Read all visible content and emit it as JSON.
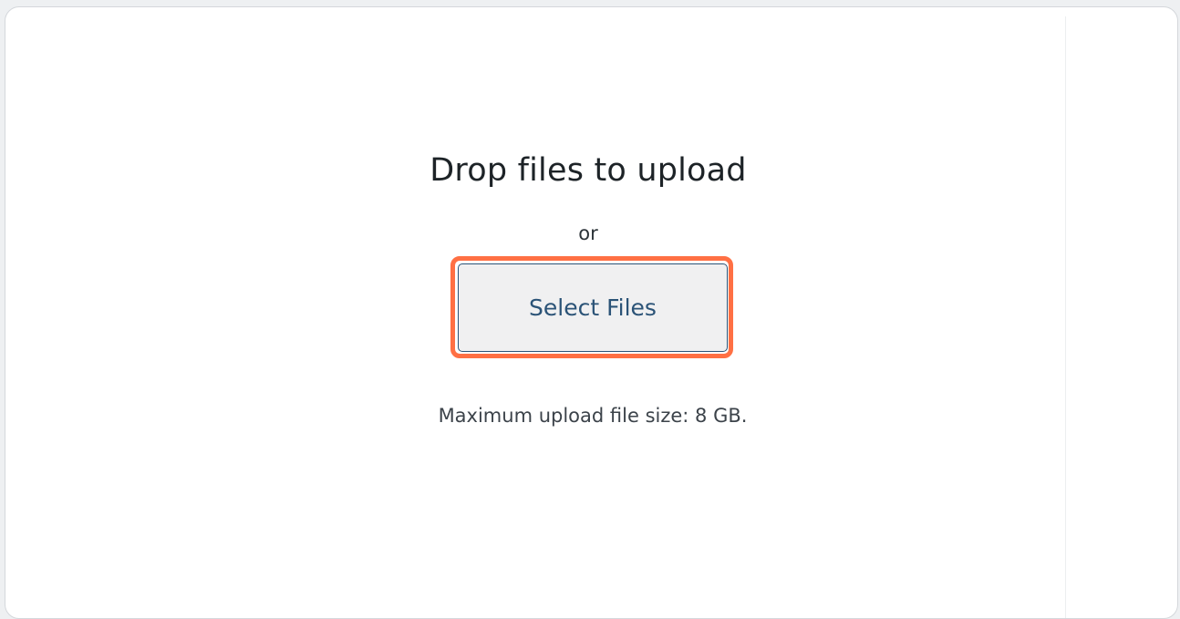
{
  "upload": {
    "title": "Drop files to upload",
    "separator": "or",
    "select_button_label": "Select Files",
    "max_size_note": "Maximum upload file size: 8 GB."
  },
  "colors": {
    "highlight": "#ff7044",
    "button_text": "#2b5377",
    "button_bg": "#f0f0f1"
  }
}
